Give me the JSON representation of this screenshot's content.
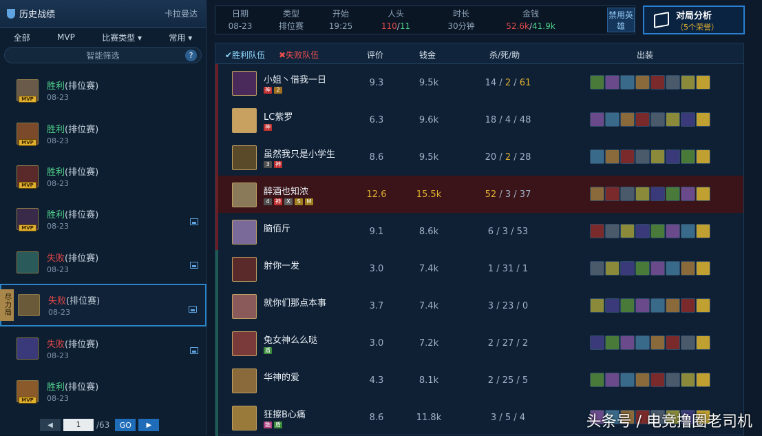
{
  "sidebar": {
    "title": "历史战绩",
    "server": "卡拉曼达",
    "filters": [
      "全部",
      "MVP",
      "比赛类型 ▾",
      "常用 ▾"
    ],
    "smart_filter": "智能筛选",
    "help": "?",
    "matches": [
      {
        "result": "胜利",
        "mode": "(排位赛)",
        "date": "08-23",
        "win": true,
        "mvp": true,
        "pic": false,
        "color": "#6a5a4a"
      },
      {
        "result": "胜利",
        "mode": "(排位赛)",
        "date": "08-23",
        "win": true,
        "mvp": true,
        "pic": false,
        "color": "#7a4a2a"
      },
      {
        "result": "胜利",
        "mode": "(排位赛)",
        "date": "08-23",
        "win": true,
        "mvp": true,
        "pic": false,
        "color": "#5a2a2a"
      },
      {
        "result": "胜利",
        "mode": "(排位赛)",
        "date": "08-23",
        "win": true,
        "mvp": true,
        "pic": true,
        "color": "#3a2a4a"
      },
      {
        "result": "失败",
        "mode": "(排位赛)",
        "date": "08-23",
        "win": false,
        "mvp": false,
        "pic": true,
        "color": "#2a5a5a"
      },
      {
        "result": "失败",
        "mode": "(排位赛)",
        "date": "08-23",
        "win": false,
        "mvp": false,
        "pic": true,
        "color": "#6a5a3a",
        "tag": "尽力局"
      },
      {
        "result": "失败",
        "mode": "(排位赛)",
        "date": "08-23",
        "win": false,
        "mvp": false,
        "pic": true,
        "color": "#3a3a7a"
      },
      {
        "result": "胜利",
        "mode": "(排位赛)",
        "date": "08-23",
        "win": true,
        "mvp": true,
        "pic": false,
        "color": "#8a5a2a"
      }
    ],
    "pager": {
      "page": "1",
      "total": "/63",
      "go": "GO"
    }
  },
  "summary": {
    "date_label": "日期",
    "date": "08-23",
    "type_label": "类型",
    "type": "排位赛",
    "start_label": "开始",
    "start": "19:25",
    "kills_label": "人头",
    "kills_red": "110",
    "kills_sep": "/",
    "kills_green": "11",
    "duration_label": "时长",
    "duration": "30分钟",
    "gold_label": "金钱",
    "gold_red": "52.6k",
    "gold_sep": "/",
    "gold_green": "41.9k",
    "ban_label": "禁用英雄"
  },
  "analysis": {
    "title": "对局分析",
    "sub": "（5个荣誉）"
  },
  "table": {
    "win_team": "胜利队伍",
    "loss_team": "失败队伍",
    "col_rating": "评价",
    "col_gold": "钱金",
    "col_kda": "杀/死/助",
    "col_items": "出装",
    "players": [
      {
        "name": "小姐丶借我一日",
        "rating": "9.3",
        "gold": "9.5k",
        "k": "14",
        "d": "2",
        "a": "61",
        "dhi": true,
        "team": "w",
        "hl": false,
        "badges": [
          "神",
          "2"
        ],
        "color": "#4a2a5a"
      },
      {
        "name": "LC紫罗",
        "rating": "6.3",
        "gold": "9.6k",
        "k": "18",
        "d": "4",
        "a": "48",
        "dhi": false,
        "team": "w",
        "hl": false,
        "badges": [
          "神"
        ],
        "color": "#c8a060"
      },
      {
        "name": "虽然我只是小学生",
        "rating": "8.6",
        "gold": "9.5k",
        "k": "20",
        "d": "2",
        "a": "28",
        "dhi": true,
        "team": "w",
        "hl": false,
        "badges": [
          "3",
          "神"
        ],
        "color": "#5a4a2a"
      },
      {
        "name": "醉酒也知浓",
        "rating": "12.6",
        "gold": "15.5k",
        "k": "52",
        "d": "3",
        "a": "37",
        "dhi": false,
        "team": "w",
        "hl": true,
        "badges": [
          "4",
          "神",
          "X",
          "S",
          "M"
        ],
        "color": "#8a7a5a"
      },
      {
        "name": "脑佰斤",
        "rating": "9.1",
        "gold": "8.6k",
        "k": "6",
        "d": "3",
        "a": "53",
        "dhi": false,
        "team": "w",
        "hl": false,
        "badges": [],
        "color": "#7a6a9a"
      },
      {
        "name": "射你一发",
        "rating": "3.0",
        "gold": "7.4k",
        "k": "1",
        "d": "31",
        "a": "1",
        "dhi": false,
        "team": "l",
        "hl": false,
        "badges": [],
        "color": "#5a2a2a"
      },
      {
        "name": "就你们那点本事",
        "rating": "3.7",
        "gold": "7.4k",
        "k": "3",
        "d": "23",
        "a": "0",
        "dhi": false,
        "team": "l",
        "hl": false,
        "badges": [],
        "color": "#8a5a5a"
      },
      {
        "name": "兔女神么么哒",
        "rating": "3.0",
        "gold": "7.2k",
        "k": "2",
        "d": "27",
        "a": "2",
        "dhi": false,
        "team": "l",
        "hl": false,
        "badges": [
          "盾"
        ],
        "color": "#7a3a3a"
      },
      {
        "name": "华神的爱",
        "rating": "4.3",
        "gold": "8.1k",
        "k": "2",
        "d": "25",
        "a": "5",
        "dhi": false,
        "team": "l",
        "hl": false,
        "badges": [],
        "color": "#8a6a3a"
      },
      {
        "name": "狂擦B心痛",
        "rating": "8.6",
        "gold": "11.8k",
        "k": "3",
        "d": "5",
        "a": "4",
        "dhi": false,
        "team": "l",
        "hl": false,
        "badges": [
          "骷",
          "盾"
        ],
        "color": "#9a7a3a"
      }
    ]
  },
  "watermark": "头条号 / 电竞撸圈老司机",
  "colors": {
    "win": "#4fd08a",
    "loss": "#e24848",
    "accent": "#2a85c9",
    "gold": "#e0b030"
  }
}
